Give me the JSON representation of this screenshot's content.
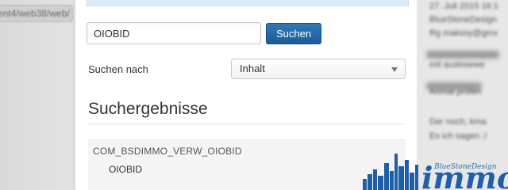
{
  "left": {
    "path_fragment": "ent4/web38/web/"
  },
  "search": {
    "value": "OIOBID",
    "button_label": "Suchen"
  },
  "search_for": {
    "label": "Suchen nach",
    "selected": "Inhalt"
  },
  "results": {
    "title": "Suchergebnisse",
    "items": [
      {
        "key": "COM_BSDIMMO_VERW_OIOBID",
        "value": "OIOBID"
      }
    ]
  },
  "right_column": {
    "lines": [
      "27. Juli 2015 16:1",
      "BlueStoneDesign",
      "Rg makssy@gmx",
      "mit auslosewe",
      "Anmal prüfen",
      "Der noch, kma",
      "Es ich sagen :/"
    ]
  },
  "logo": {
    "text": "immo",
    "tagline": "BlueStoneDesign",
    "color": "#1f5fa8"
  },
  "colors": {
    "accent": "#1c5c98",
    "info_strip": "#d9ecf7"
  }
}
